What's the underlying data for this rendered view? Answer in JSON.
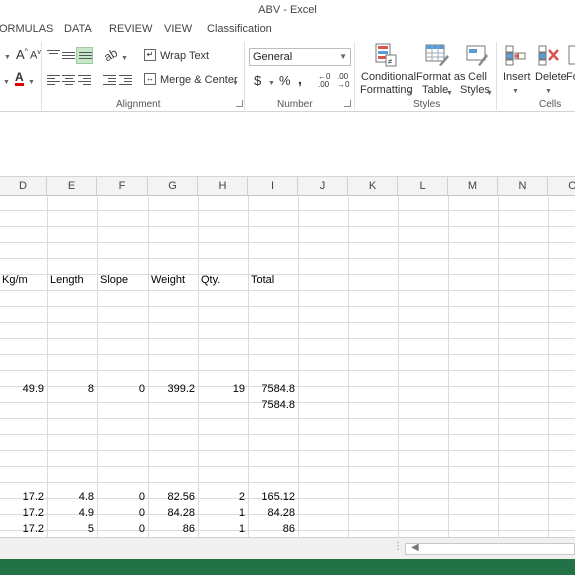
{
  "window": {
    "title": "ABV - Excel"
  },
  "tabs": [
    "ORMULAS",
    "DATA",
    "REVIEW",
    "VIEW",
    "Classification"
  ],
  "ribbon": {
    "alignment": {
      "wrap_text": "Wrap Text",
      "merge_center": "Merge & Center",
      "label": "Alignment"
    },
    "number": {
      "format": "General",
      "currency": "$",
      "percent": "%",
      "comma": ",",
      "label": "Number"
    },
    "styles": {
      "conditional_1": "Conditional",
      "conditional_2": "Formatting",
      "format_table_1": "Format as",
      "format_table_2": "Table",
      "cell_styles_1": "Cell",
      "cell_styles_2": "Styles",
      "label": "Styles"
    },
    "cells": {
      "insert": "Insert",
      "delete": "Delete",
      "format_partial": "Fo",
      "label": "Cells"
    }
  },
  "columns": [
    "D",
    "E",
    "F",
    "G",
    "H",
    "I",
    "J",
    "K",
    "L",
    "M",
    "N",
    "O"
  ],
  "headers": {
    "kgm": "Kg/m",
    "length": "Length",
    "slope": "Slope",
    "weight": "Weight",
    "qty": "Qty.",
    "total": "Total"
  },
  "rows": [
    {
      "kgm": "49.9",
      "length": "8",
      "slope": "0",
      "weight": "399.2",
      "qty": "19",
      "total": "7584.8"
    },
    {
      "subtotal": "7584.8"
    },
    {
      "kgm": "17.2",
      "length": "4.8",
      "slope": "0",
      "weight": "82.56",
      "qty": "2",
      "total": "165.12"
    },
    {
      "kgm": "17.2",
      "length": "4.9",
      "slope": "0",
      "weight": "84.28",
      "qty": "1",
      "total": "84.28"
    },
    {
      "kgm": "17.2",
      "length": "5",
      "slope": "0",
      "weight": "86",
      "qty": "1",
      "total": "86"
    }
  ],
  "colors": {
    "accent": "#217346",
    "highlight": "#c5e8c9"
  }
}
